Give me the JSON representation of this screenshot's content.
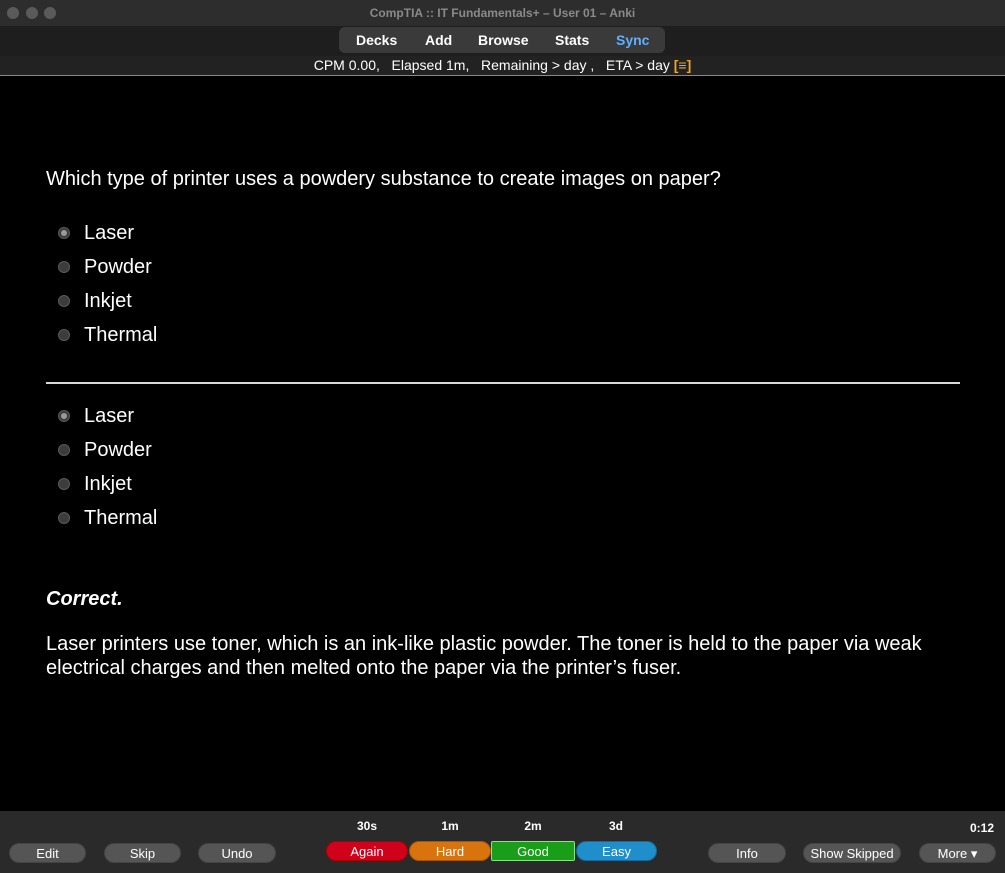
{
  "window": {
    "title": "CompTIA :: IT Fundamentals+   – User 01 – Anki"
  },
  "toolbar": {
    "items": [
      {
        "label": "Decks"
      },
      {
        "label": "Add"
      },
      {
        "label": "Browse"
      },
      {
        "label": "Stats"
      },
      {
        "label": "Sync",
        "color": "#5fb0ff"
      }
    ]
  },
  "status": {
    "text": "CPM 0.00,   Elapsed 1m,   Remaining > day ,   ETA > day ",
    "icon": "[≡]",
    "icon_color": "#f5a623"
  },
  "card": {
    "question": "Which type of printer uses a powdery substance to create images on paper?",
    "front_options": [
      {
        "label": "Laser",
        "checked": true
      },
      {
        "label": "Powder",
        "checked": false
      },
      {
        "label": "Inkjet",
        "checked": false
      },
      {
        "label": "Thermal",
        "checked": false
      }
    ],
    "back_options": [
      {
        "label": "Laser",
        "checked": true
      },
      {
        "label": "Powder",
        "checked": false
      },
      {
        "label": "Inkjet",
        "checked": false
      },
      {
        "label": "Thermal",
        "checked": false
      }
    ],
    "result": "Correct.",
    "explanation": "Laser printers use toner, which is an ink-like plastic powder. The toner is held to the paper via weak electrical charges and then melted onto the paper via the printer’s fuser."
  },
  "bottom": {
    "left_buttons": [
      {
        "label": "Edit"
      },
      {
        "label": "Skip"
      },
      {
        "label": "Undo"
      }
    ],
    "answers": [
      {
        "time": "30s",
        "label": "Again",
        "color": "#d0021b"
      },
      {
        "time": "1m",
        "label": "Hard",
        "color": "#d9730d"
      },
      {
        "time": "2m",
        "label": "Good",
        "color": "#1a9e1a"
      },
      {
        "time": "3d",
        "label": "Easy",
        "color": "#1f8ecb"
      }
    ],
    "right_buttons": [
      {
        "label": "Info"
      },
      {
        "label": "Show Skipped"
      },
      {
        "label": "More ▾"
      }
    ],
    "timer": "0:12"
  }
}
